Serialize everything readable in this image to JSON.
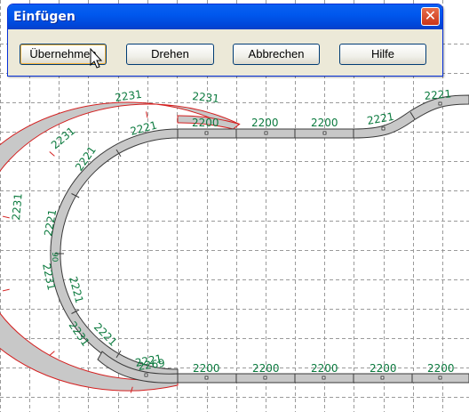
{
  "dialog": {
    "title": "Einfügen",
    "buttons": {
      "apply": "Übernehmen",
      "rotate": "Drehen",
      "cancel": "Abbrechen",
      "help": "Hilfe"
    }
  },
  "track_labels": {
    "sel_top_1": "2231",
    "sel_top_2": "2231",
    "sel_left_1": "2231",
    "sel_left_2": "2231",
    "sel_left_3": "2231",
    "sel_left_4": "2231",
    "inner_1": "2221",
    "inner_2": "2221",
    "inner_3": "2221",
    "inner_4": "2221",
    "inner_5": "2221",
    "inner_6": "2221",
    "small_90": "90",
    "upper_s1": "2200",
    "upper_s2": "2200",
    "upper_s3": "2200",
    "upper_s4": "2200",
    "upper_c1": "2221",
    "upper_c2": "2221",
    "lower_curve": "2269",
    "lower_s1": "2200",
    "lower_s2": "2200",
    "lower_s3": "2200",
    "lower_s4": "2200",
    "lower_s5": "2200"
  },
  "colors": {
    "label_green": "#0b7a3e",
    "selection_red": "#d42020",
    "grid_dash": "#9a9a9a",
    "track_fill": "#c8c8c8",
    "title_blue": "#0058ee"
  }
}
